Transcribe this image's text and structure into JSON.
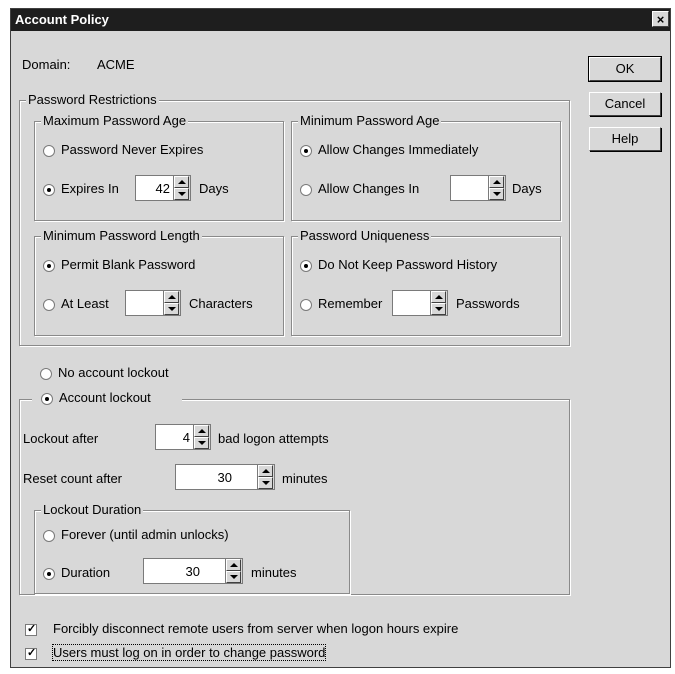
{
  "window": {
    "title": "Account Policy",
    "close_label": "×"
  },
  "domain": {
    "label": "Domain:",
    "value": "ACME"
  },
  "buttons": {
    "ok": "OK",
    "cancel": "Cancel",
    "help": "Help"
  },
  "password_restrictions": {
    "title": "Password Restrictions",
    "max_age": {
      "title": "Maximum Password Age",
      "never_expires": "Password Never Expires",
      "expires_in": "Expires In",
      "days_value": "42",
      "days_label": "Days",
      "selected": "expires_in"
    },
    "min_age": {
      "title": "Minimum Password Age",
      "allow_immediately": "Allow Changes Immediately",
      "allow_in": "Allow Changes In",
      "days_value": "",
      "days_label": "Days",
      "selected": "allow_immediately"
    },
    "min_length": {
      "title": "Minimum Password Length",
      "permit_blank": "Permit Blank Password",
      "at_least": "At Least",
      "chars_value": "",
      "chars_label": "Characters",
      "selected": "permit_blank"
    },
    "uniqueness": {
      "title": "Password Uniqueness",
      "no_history": "Do Not Keep Password History",
      "remember": "Remember",
      "passwords_value": "",
      "passwords_label": "Passwords",
      "selected": "no_history"
    }
  },
  "lockout": {
    "no_lockout": "No account lockout",
    "account_lockout": "Account lockout",
    "selected": "account_lockout",
    "lockout_after_label": "Lockout after",
    "lockout_after_value": "4",
    "bad_logon_label": "bad logon attempts",
    "reset_count_label": "Reset count after",
    "reset_count_value": "30",
    "reset_minutes_label": "minutes",
    "duration": {
      "title": "Lockout Duration",
      "forever": "Forever (until admin unlocks)",
      "duration_label": "Duration",
      "duration_value": "30",
      "minutes_label": "minutes",
      "selected": "duration"
    }
  },
  "options": {
    "forcibly_disconnect": {
      "label": "Forcibly disconnect remote users from server when logon hours expire",
      "checked": true
    },
    "must_logon": {
      "label": "Users must log on in order to change password",
      "checked": true
    }
  }
}
